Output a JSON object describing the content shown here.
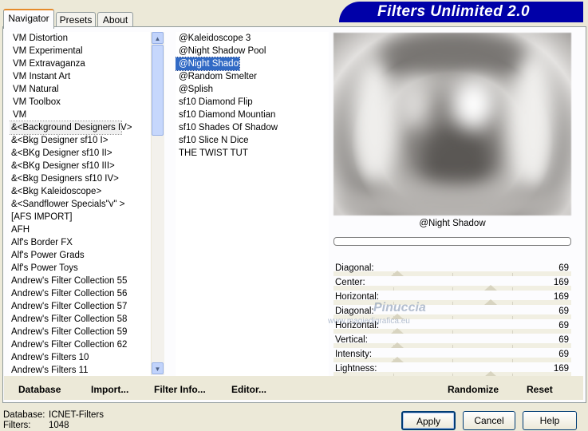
{
  "title": "Filters Unlimited 2.0",
  "tabs": [
    "Navigator",
    "Presets",
    "About"
  ],
  "categories": [
    "VM Distortion",
    "VM Experimental",
    "VM Extravaganza",
    "VM Instant Art",
    "VM Natural",
    "VM Toolbox",
    "VM",
    "&<Background Designers IV>",
    "&<Bkg Designer sf10 I>",
    "&<BKg Designer sf10 II>",
    "&<BKg Designer sf10 III>",
    "&<Bkg Designers sf10 IV>",
    "&<Bkg Kaleidoscope>",
    "&<Sandflower Specials\"v\" >",
    "[AFS IMPORT]",
    "AFH",
    "Alf's Border FX",
    "Alf's Power Grads",
    "Alf's Power Toys",
    "Andrew's Filter Collection 55",
    "Andrew's Filter Collection 56",
    "Andrew's Filter Collection 57",
    "Andrew's Filter Collection 58",
    "Andrew's Filter Collection 59",
    "Andrew's Filter Collection 62",
    "Andrew's Filters 10",
    "Andrew's Filters 11"
  ],
  "selected_category_index": 7,
  "filters": [
    "@Kaleidoscope 3",
    "@Night Shadow Pool",
    "@Night Shadow",
    "@Random Smelter",
    "@Splish",
    "sf10 Diamond Flip",
    "sf10 Diamond Mountian",
    "sf10 Shades Of Shadow",
    "sf10 Slice N Dice",
    "THE TWIST TUT"
  ],
  "selected_filter_index": 2,
  "selected_filter_name": "@Night Shadow",
  "params": [
    {
      "label": "Diagonal:",
      "value": "69",
      "level": 0.27
    },
    {
      "label": "Center:",
      "value": "169",
      "level": 0.66
    },
    {
      "label": "Horizontal:",
      "value": "169",
      "level": 0.66
    },
    {
      "label": "Diagonal:",
      "value": "69",
      "level": 0.27
    },
    {
      "label": "Horizontal:",
      "value": "69",
      "level": 0.27
    },
    {
      "label": "Vertical:",
      "value": "69",
      "level": 0.27
    },
    {
      "label": "Intensity:",
      "value": "69",
      "level": 0.27
    },
    {
      "label": "Lightness:",
      "value": "169",
      "level": 0.66
    }
  ],
  "toolbar": {
    "database": "Database",
    "import": "Import...",
    "filter_info": "Filter Info...",
    "editor": "Editor...",
    "randomize": "Randomize",
    "reset": "Reset"
  },
  "info": {
    "database_label": "Database:",
    "database_value": "ICNET-Filters",
    "filters_label": "Filters:",
    "filters_value": "1048"
  },
  "buttons": {
    "apply": "Apply",
    "cancel": "Cancel",
    "help": "Help"
  },
  "watermark": {
    "name": "Pinuccia",
    "url": "www.magiedigrafica.eu"
  }
}
